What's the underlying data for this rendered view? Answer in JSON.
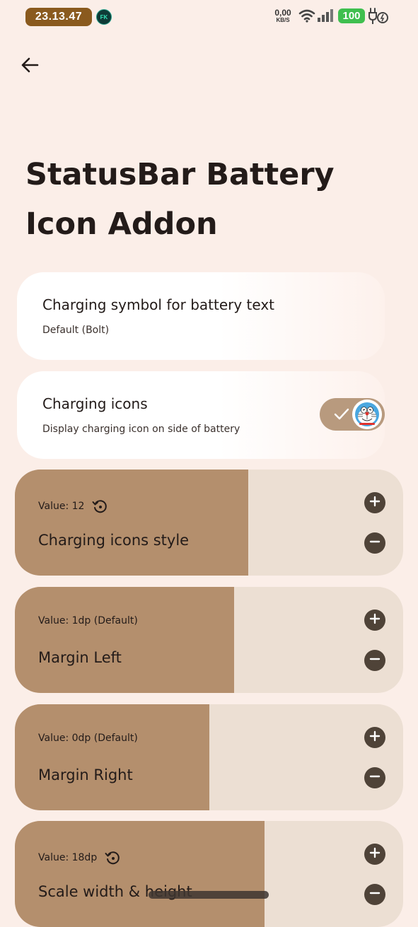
{
  "status_bar": {
    "time": "23.13.47",
    "badge": "FK",
    "net_speed_value": "0,00",
    "net_speed_unit": "KB/S",
    "battery_level": "100",
    "icons": [
      "wifi-icon",
      "cell-signal-icon",
      "charging-plug-icon"
    ],
    "battery_color": "#3fbf4f"
  },
  "header": {
    "back_icon": "arrow-left-icon",
    "title": "StatusBar Battery Icon Addon"
  },
  "settings": {
    "charging_symbol": {
      "title": "Charging symbol for battery text",
      "subtitle": "Default (Bolt)"
    },
    "charging_icons": {
      "title": "Charging icons",
      "subtitle": "Display charging icon on side of battery",
      "enabled": true
    }
  },
  "steppers": [
    {
      "value_text": "Value: 12",
      "label": "Charging icons style",
      "show_reset": true,
      "fill_fraction": 0.602
    },
    {
      "value_text": "Value: 1dp (Default)",
      "label": "Margin Left",
      "show_reset": false,
      "fill_fraction": 0.564
    },
    {
      "value_text": "Value: 0dp (Default)",
      "label": "Margin Right",
      "show_reset": false,
      "fill_fraction": 0.501
    },
    {
      "value_text": "Value: 18dp",
      "label": "Scale width & height",
      "show_reset": true,
      "fill_fraction": 0.643
    }
  ],
  "theme": {
    "background": "#fbeee8",
    "stepper_fill": "#b48f6d",
    "stepper_track": "#ecdfd3",
    "toggle_on": "#b89a7e",
    "step_button": "#4f4338"
  }
}
